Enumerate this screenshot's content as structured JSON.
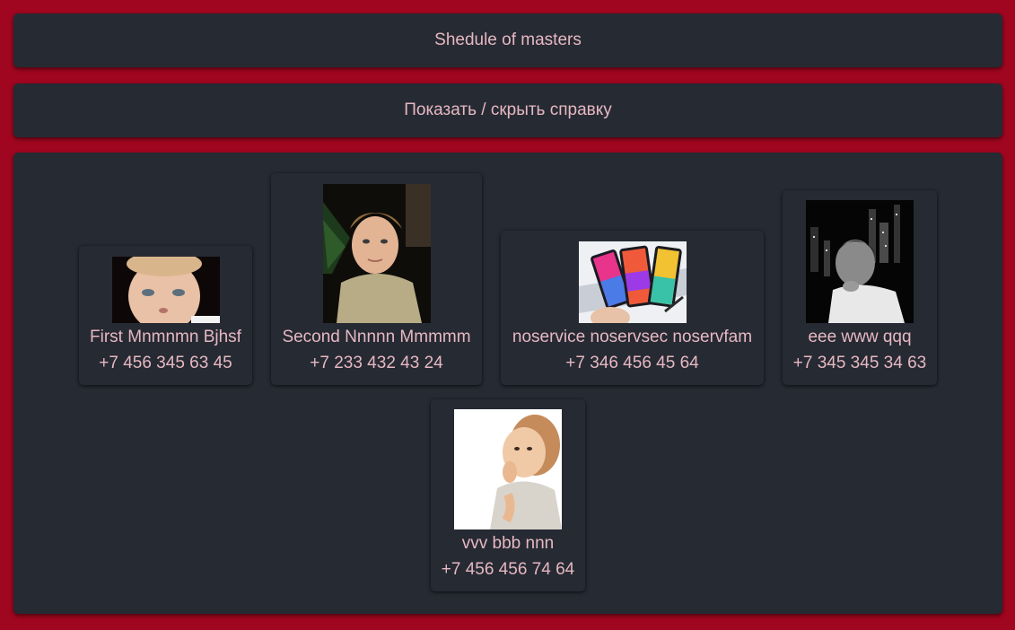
{
  "header": {
    "title": "Shedule of masters",
    "help_toggle": "Показать / скрыть справку"
  },
  "masters": [
    {
      "name": "First Mnmnmn Bjhsf",
      "phone": "+7 456 345 63 45",
      "photo_icon": "child-portrait-photo"
    },
    {
      "name": "Second Nnnnn Mmmmm",
      "phone": "+7 233 432 43 24",
      "photo_icon": "boy-portrait-photo"
    },
    {
      "name": "noservice noservsec noservfam",
      "phone": "+7 346 456 45 64",
      "photo_icon": "smartphones-photo"
    },
    {
      "name": "eee www qqq",
      "phone": "+7 345 345 34 63",
      "photo_icon": "bw-child-city-photo"
    },
    {
      "name": "vvv bbb nnn",
      "phone": "+7 456 456 74 64",
      "photo_icon": "baby-photo"
    }
  ],
  "colors": {
    "background": "#a0061f",
    "panel": "#262a33",
    "text": "#e6b8c2"
  }
}
